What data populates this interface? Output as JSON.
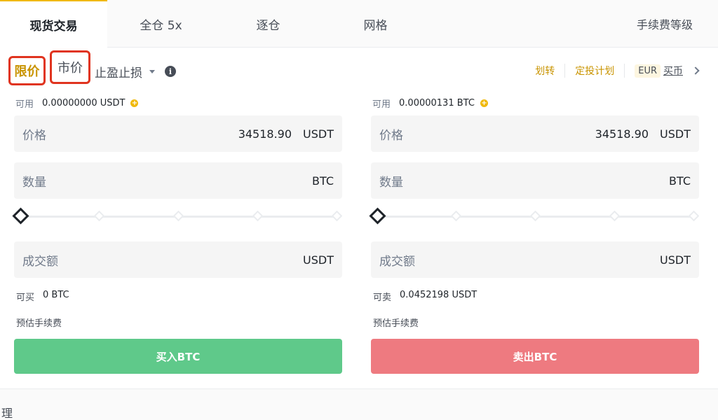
{
  "tabs": [
    {
      "label": "现货交易",
      "active": true
    },
    {
      "label": "全仓 5x",
      "active": false
    },
    {
      "label": "逐仓",
      "active": false
    },
    {
      "label": "网格",
      "active": false
    }
  ],
  "fee_tier_label": "手续费等级",
  "order_types": {
    "limit": "限价",
    "market": "市价",
    "stop": "止盈止损"
  },
  "links": {
    "transfer": "划转",
    "recurring": "定投计划",
    "currency": "EUR",
    "buy_crypto": "买币"
  },
  "buy_panel": {
    "available_label": "可用",
    "available_value": "0.00000000 USDT",
    "price_label": "价格",
    "price_value": "34518.90",
    "price_unit": "USDT",
    "amount_label": "数量",
    "amount_unit": "BTC",
    "total_label": "成交额",
    "total_unit": "USDT",
    "max_label": "可买",
    "max_value": "0 BTC",
    "fee_label": "预估手续费",
    "button_label": "买入BTC",
    "slider_percent": 0
  },
  "sell_panel": {
    "available_label": "可用",
    "available_value": "0.00000131 BTC",
    "price_label": "价格",
    "price_value": "34518.90",
    "price_unit": "USDT",
    "amount_label": "数量",
    "amount_unit": "BTC",
    "total_label": "成交额",
    "total_unit": "USDT",
    "max_label": "可卖",
    "max_value": "0.0452198 USDT",
    "fee_label": "预估手续费",
    "button_label": "卖出BTC",
    "slider_percent": 0
  },
  "footer_text": "理",
  "colors": {
    "accent": "#f0b90b",
    "buy": "#5fc98a",
    "sell": "#ee7a80",
    "highlight_box": "#e0341f"
  },
  "icons": [
    "caret-down-icon",
    "info-icon",
    "chevron-right-icon",
    "plus-circle-icon",
    "slider-diamond-icon"
  ]
}
